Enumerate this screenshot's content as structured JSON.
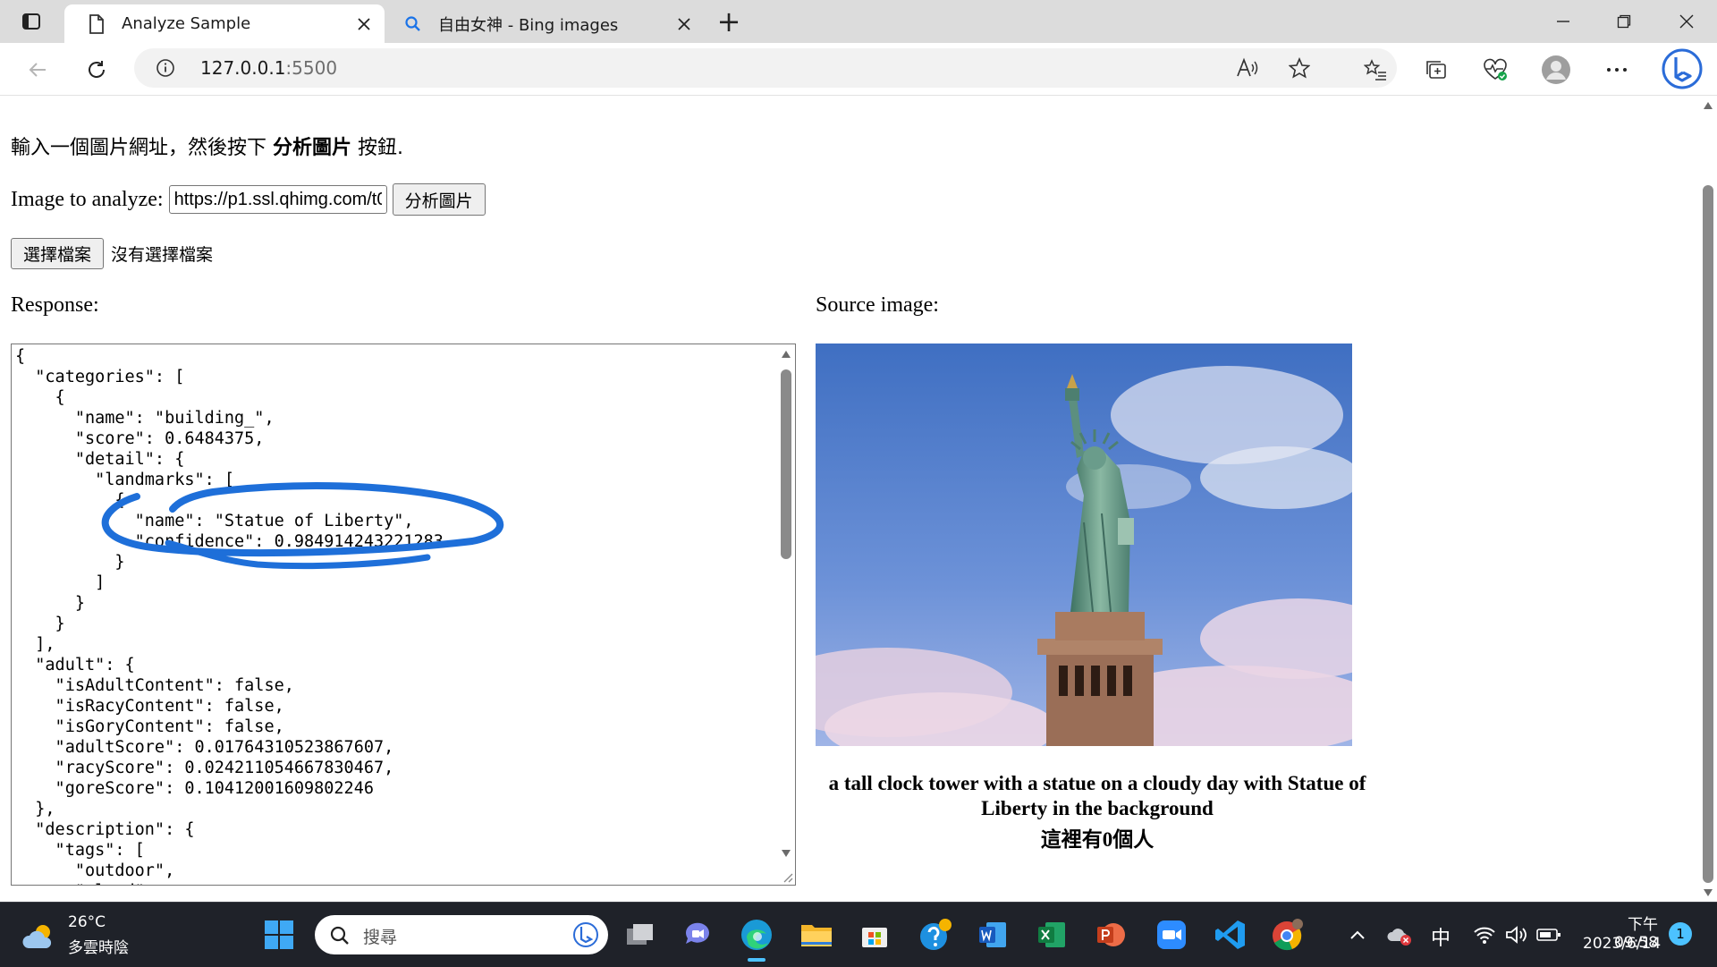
{
  "browser": {
    "tabs": [
      {
        "title": "Analyze Sample",
        "active": true,
        "icon": "page-icon"
      },
      {
        "title": "自由女神 - Bing images",
        "active": false,
        "icon": "bing-search-icon"
      }
    ],
    "new_tab_symbol": "+",
    "address": {
      "host": "127.0.0.1",
      "port": ":5500"
    }
  },
  "page": {
    "instructions_prefix": "輸入一個圖片網址，然後按下 ",
    "instructions_bold": "分析圖片",
    "instructions_suffix": " 按鈕.",
    "image_input_label": "Image to analyze:",
    "image_input_value": "https://p1.ssl.qhimg.com/t01",
    "analyze_button": "分析圖片",
    "choose_file_button": "選擇檔案",
    "no_file_text": "沒有選擇檔案",
    "response_label": "Response:",
    "source_label": "Source image:",
    "response_json": "{\n  \"categories\": [\n    {\n      \"name\": \"building_\",\n      \"score\": 0.6484375,\n      \"detail\": {\n        \"landmarks\": [\n          {\n            \"name\": \"Statue of Liberty\",\n            \"confidence\": 0.984914243221283\n          }\n        ]\n      }\n    }\n  ],\n  \"adult\": {\n    \"isAdultContent\": false,\n    \"isRacyContent\": false,\n    \"isGoryContent\": false,\n    \"adultScore\": 0.01764310523867607,\n    \"racyScore\": 0.024211054667830467,\n    \"goreScore\": 0.10412001609802246\n  },\n  \"description\": {\n    \"tags\": [\n      \"outdoor\",\n      \"cloud\",",
    "caption_line1": "a tall clock tower with a statue on a cloudy day with Statue of",
    "caption_line2": "Liberty in the background",
    "people_count": "這裡有0個人"
  },
  "taskbar": {
    "weather_temp": "26°C",
    "weather_desc": "多雲時陰",
    "search_placeholder": "搜尋",
    "ime": "中",
    "time": "下午 09:58",
    "date": "2023/6/14",
    "notification_count": "1"
  },
  "colors": {
    "annotation": "#1e6fd9",
    "taskbar_bg": "#1f2229",
    "tabbar_bg": "#dcdcdc"
  }
}
